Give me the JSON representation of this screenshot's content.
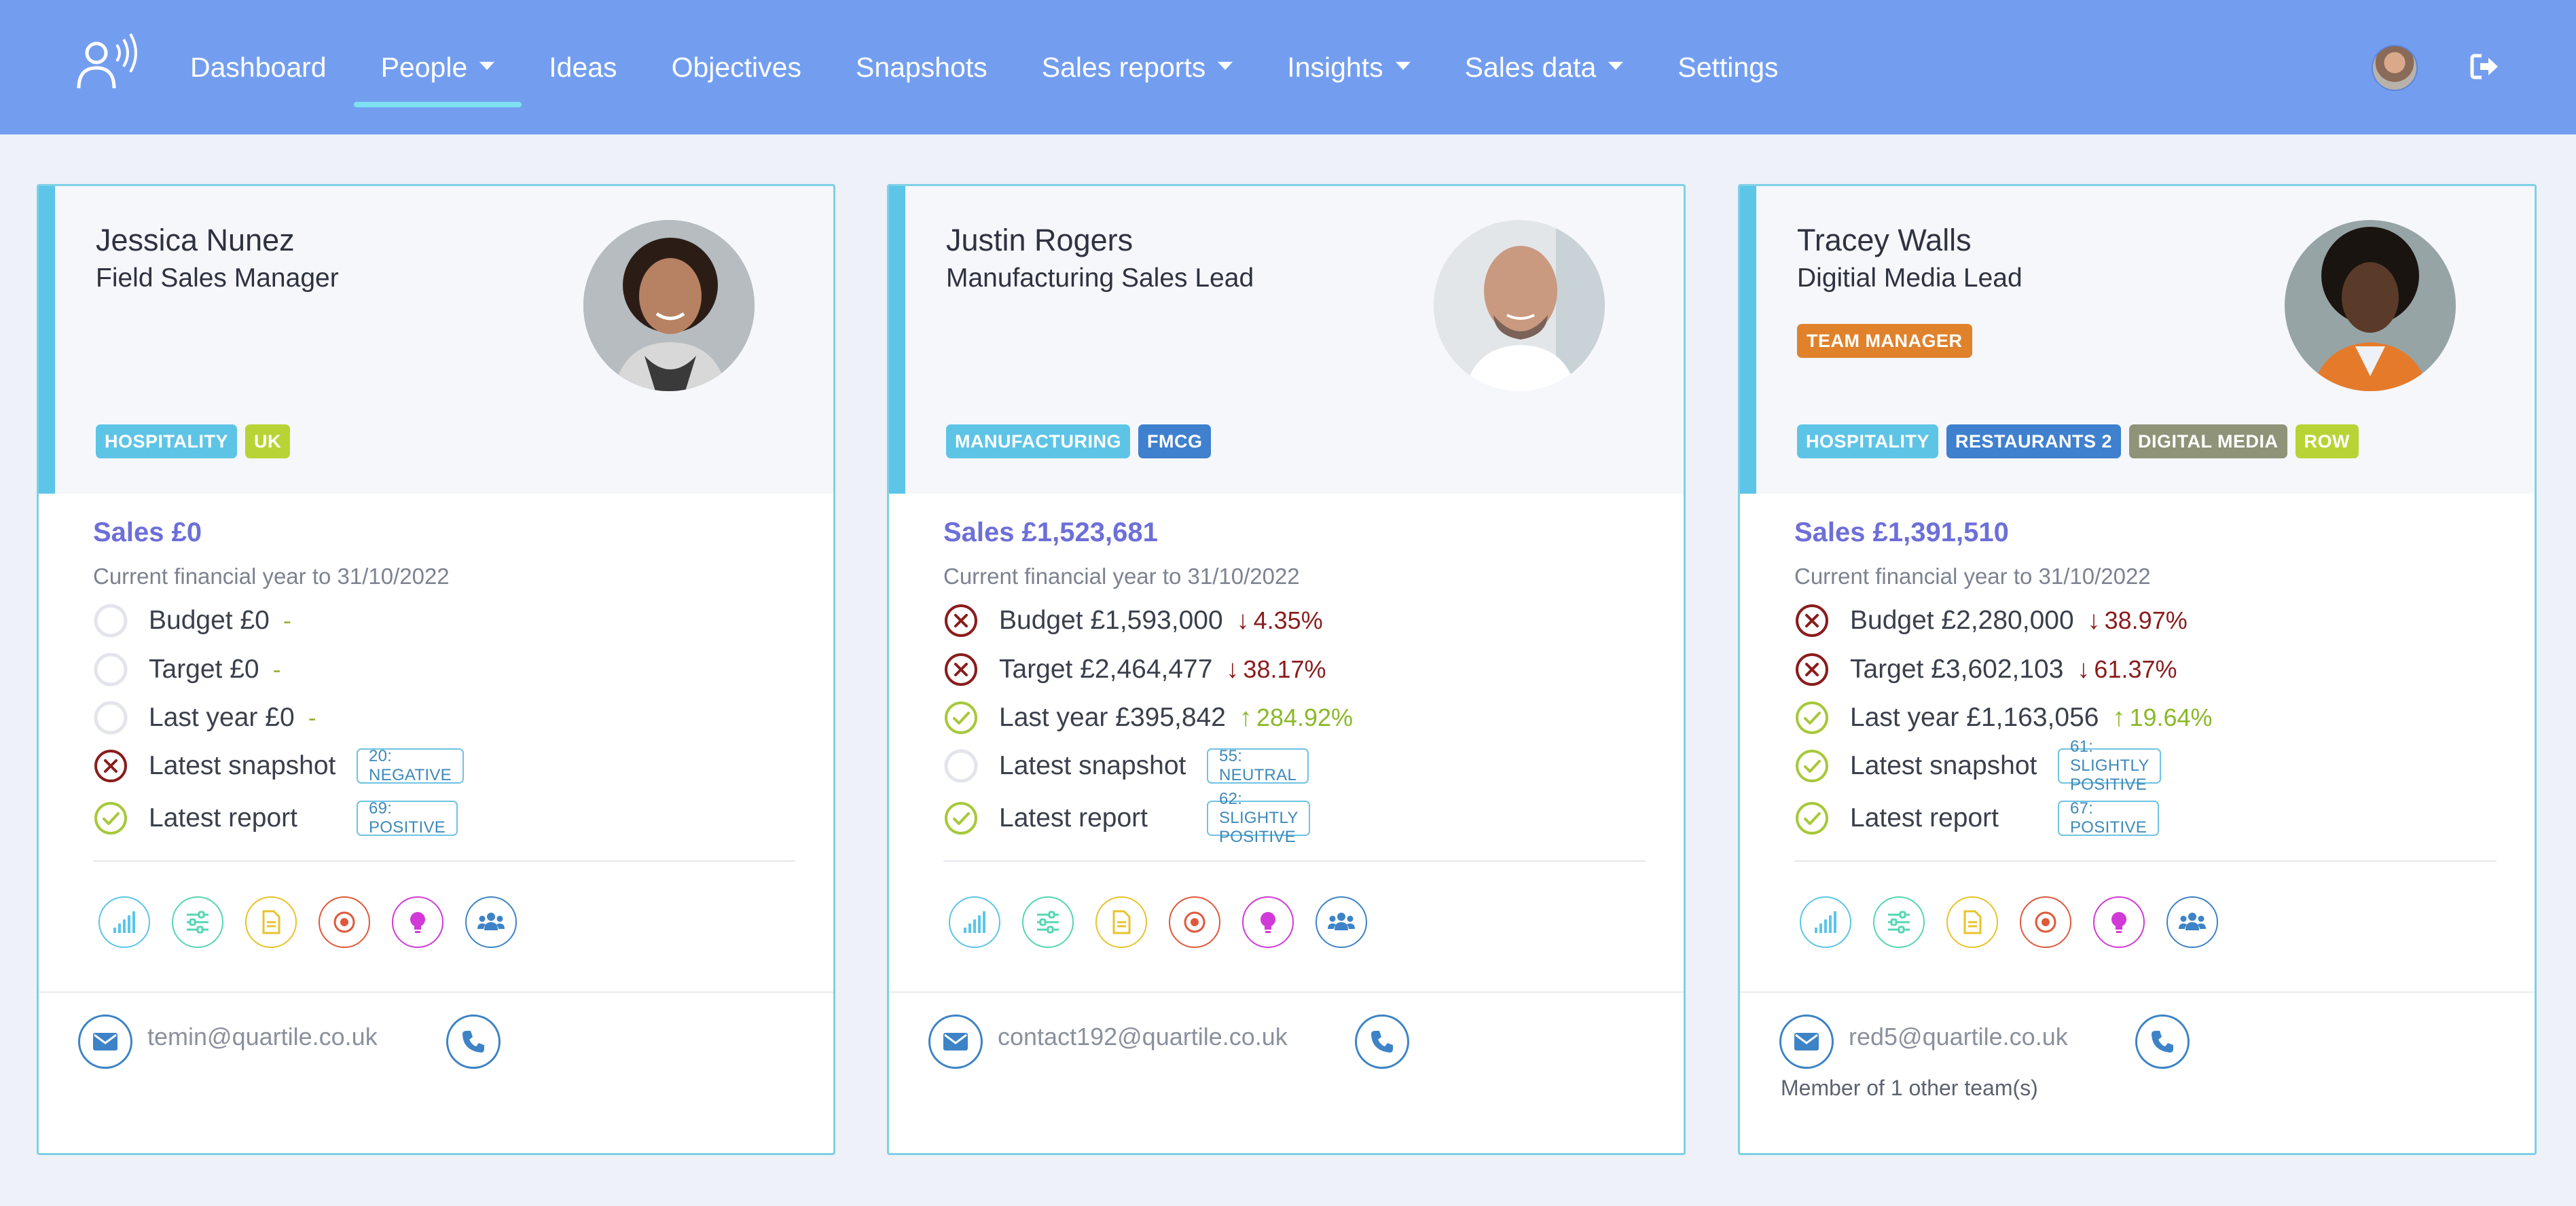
{
  "nav": {
    "items": [
      {
        "label": "Dashboard",
        "dropdown": false,
        "active": false
      },
      {
        "label": "People",
        "dropdown": true,
        "active": true
      },
      {
        "label": "Ideas",
        "dropdown": false,
        "active": false
      },
      {
        "label": "Objectives",
        "dropdown": false,
        "active": false
      },
      {
        "label": "Snapshots",
        "dropdown": false,
        "active": false
      },
      {
        "label": "Sales reports",
        "dropdown": true,
        "active": false
      },
      {
        "label": "Insights",
        "dropdown": true,
        "active": false
      },
      {
        "label": "Sales data",
        "dropdown": true,
        "active": false
      },
      {
        "label": "Settings",
        "dropdown": false,
        "active": false
      }
    ],
    "logo_icon": "speaking-person-icon",
    "avatar_icon": "user-avatar",
    "logout_icon": "sign-out-icon"
  },
  "colors": {
    "navbar": "#739ef0",
    "accent_stripe": "#5cc5e8",
    "sales": "#6d6fd8",
    "negative": "#8a1c1c",
    "positive": "#8ab828"
  },
  "cards": [
    {
      "name": "Jessica Nunez",
      "title": "Field Sales Manager",
      "role_badge": "",
      "tags": [
        {
          "label": "HOSPITALITY",
          "color": "#5ec4e6"
        },
        {
          "label": "UK",
          "color": "#b8d335"
        }
      ],
      "sales": "Sales £0",
      "financial_year": "Current financial year to 31/10/2022",
      "budget": {
        "label": "Budget £0",
        "status": "none",
        "delta": "-"
      },
      "target": {
        "label": "Target £0",
        "status": "none",
        "delta": "-"
      },
      "last_year": {
        "label": "Last year £0",
        "status": "none",
        "delta": "-"
      },
      "latest_snapshot": {
        "label": "Latest snapshot",
        "status": "negative",
        "badge": "20: NEGATIVE"
      },
      "latest_report": {
        "label": "Latest report",
        "status": "positive",
        "badge": "69: POSITIVE"
      },
      "email": "temin@quartile.co.uk",
      "other_teams": ""
    },
    {
      "name": "Justin Rogers",
      "title": "Manufacturing Sales Lead",
      "role_badge": "",
      "tags": [
        {
          "label": "MANUFACTURING",
          "color": "#5ec4e6"
        },
        {
          "label": "FMCG",
          "color": "#3f80cf"
        }
      ],
      "sales": "Sales £1,523,681",
      "financial_year": "Current financial year to 31/10/2022",
      "budget": {
        "label": "Budget £1,593,000",
        "status": "negative",
        "delta": "4.35%"
      },
      "target": {
        "label": "Target £2,464,477",
        "status": "negative",
        "delta": "38.17%"
      },
      "last_year": {
        "label": "Last year £395,842",
        "status": "positive",
        "delta": "284.92%"
      },
      "latest_snapshot": {
        "label": "Latest snapshot",
        "status": "none",
        "badge": "55: NEUTRAL"
      },
      "latest_report": {
        "label": "Latest report",
        "status": "positive",
        "badge": "62: SLIGHTLY POSITIVE"
      },
      "email": "contact192@quartile.co.uk",
      "other_teams": ""
    },
    {
      "name": "Tracey Walls",
      "title": "Digitial Media Lead",
      "role_badge": "TEAM MANAGER",
      "tags": [
        {
          "label": "HOSPITALITY",
          "color": "#5ec4e6"
        },
        {
          "label": "RESTAURANTS 2",
          "color": "#3f80cf"
        },
        {
          "label": "DIGITAL MEDIA",
          "color": "#8f9378"
        },
        {
          "label": "ROW",
          "color": "#b8d335"
        }
      ],
      "sales": "Sales £1,391,510",
      "financial_year": "Current financial year to 31/10/2022",
      "budget": {
        "label": "Budget £2,280,000",
        "status": "negative",
        "delta": "38.97%"
      },
      "target": {
        "label": "Target £3,602,103",
        "status": "negative",
        "delta": "61.37%"
      },
      "last_year": {
        "label": "Last year £1,163,056",
        "status": "positive",
        "delta": "19.64%"
      },
      "latest_snapshot": {
        "label": "Latest snapshot",
        "status": "positive",
        "badge": "61: SLIGHTLY POSITIVE"
      },
      "latest_report": {
        "label": "Latest report",
        "status": "positive",
        "badge": "67: POSITIVE"
      },
      "email": "red5@quartile.co.uk",
      "other_teams": "Member of 1 other team(s)"
    }
  ],
  "action_icons": [
    {
      "name": "sales-chart-icon",
      "color": "#5cc5e8"
    },
    {
      "name": "sliders-icon",
      "color": "#55d6b4"
    },
    {
      "name": "document-icon",
      "color": "#e8c32c"
    },
    {
      "name": "target-icon",
      "color": "#e0583a"
    },
    {
      "name": "lightbulb-icon",
      "color": "#d23ad8"
    },
    {
      "name": "team-icon",
      "color": "#3d83c6"
    }
  ]
}
